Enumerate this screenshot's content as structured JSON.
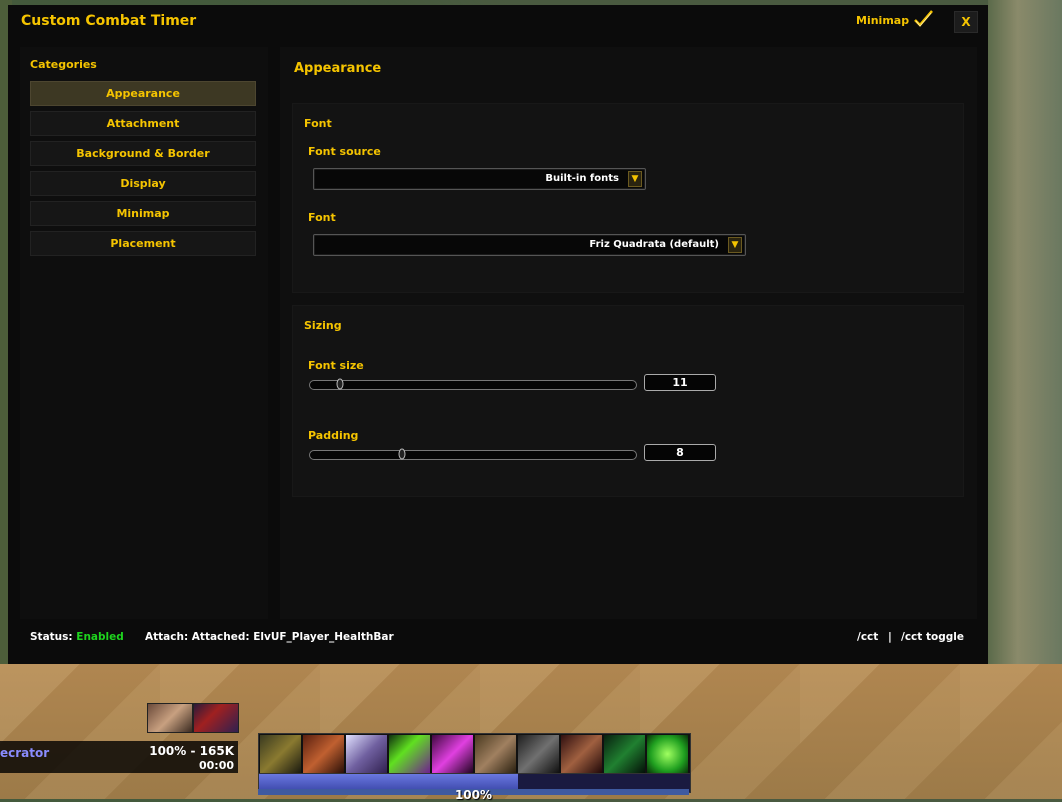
{
  "window": {
    "title": "Custom Combat Timer",
    "minimap_label": "Minimap",
    "minimap_checked": true,
    "close_label": "X"
  },
  "sidebar": {
    "title": "Categories",
    "items": [
      {
        "label": "Appearance",
        "active": true
      },
      {
        "label": "Attachment",
        "active": false
      },
      {
        "label": "Background & Border",
        "active": false
      },
      {
        "label": "Display",
        "active": false
      },
      {
        "label": "Minimap",
        "active": false
      },
      {
        "label": "Placement",
        "active": false
      }
    ]
  },
  "main": {
    "title": "Appearance",
    "font_group": {
      "title": "Font",
      "font_source_label": "Font source",
      "font_source_value": "Built-in fonts",
      "font_label": "Font",
      "font_value": "Friz Quadrata (default)"
    },
    "sizing_group": {
      "title": "Sizing",
      "font_size_label": "Font size",
      "font_size_value": "11",
      "padding_label": "Padding",
      "padding_value": "8"
    }
  },
  "status": {
    "status_label": "Status:",
    "status_value": "Enabled",
    "attach_text": "Attach: Attached: ElvUF_Player_HealthBar",
    "cmd_cct": "/cct",
    "separator": "|",
    "cmd_toggle": "/cct toggle"
  },
  "hud": {
    "unit_name": "ecrator",
    "unit_hp": "100% - 165K",
    "unit_timer": "00:00",
    "cast_percent": "100%"
  },
  "colors": {
    "accent": "#f5c400",
    "enabled": "#1ed41e",
    "window_bg": "#0b0b0b"
  }
}
